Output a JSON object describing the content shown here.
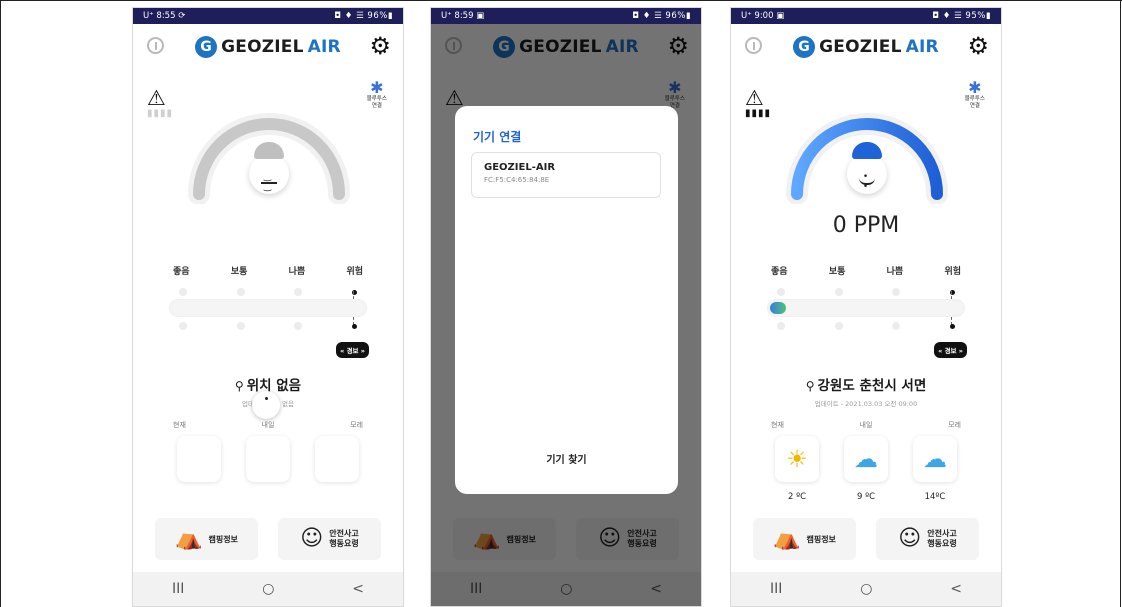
{
  "app": {
    "logo_main": "GEOZIEL",
    "logo_air": "AIR",
    "logo_mark": "G"
  },
  "levels": [
    "좋음",
    "보통",
    "나쁨",
    "위험"
  ],
  "days": [
    "현재",
    "내일",
    "모레"
  ],
  "alert_badge": "« 경보 »",
  "bluetooth": {
    "line1": "블루투스",
    "line2": "연결"
  },
  "bottom_buttons": {
    "camping": "캠핑정보",
    "safety_l1": "안전사고",
    "safety_l2": "행동요령"
  },
  "nav": {
    "recent": "III",
    "home": "○",
    "back": "<"
  },
  "screens": [
    {
      "status_time": "U⁺ 8:55 ⟳",
      "status_right": "◘ ♦ ☰ 96%▮",
      "location": "위치 없음",
      "updated": "업데이트 정보 없음",
      "warn_level": "0"
    },
    {
      "status_time": "U⁺ 8:59 ▣",
      "status_right": "◘ ♦ ☰ 96%▮",
      "dialog": {
        "title": "기기 연결",
        "device_name": "GEOZIEL-AIR",
        "device_mac": "FC:F5:C4:65:84:8E",
        "scan_button": "기기 찾기"
      }
    },
    {
      "status_time": "U⁺ 9:00 ▣",
      "status_right": "◘ ♦ ☰ 95%▮",
      "ppm": "0 PPM",
      "location": "강원도 춘천시 서면",
      "updated": "업데이트 - 2021.03.03 오전 09:00",
      "warn_level": "0",
      "weather": [
        {
          "icon": "sun-icon",
          "temp": "2 ºC"
        },
        {
          "icon": "cloudy-icon",
          "temp": "9 ºC"
        },
        {
          "icon": "cloudy-icon",
          "temp": "14ºC"
        }
      ],
      "gauge_level": 0.08
    }
  ],
  "colors": {
    "accent": "#1f63d6",
    "brand": "#1f73c5",
    "gauge_inactive": "#c8c8c8"
  }
}
